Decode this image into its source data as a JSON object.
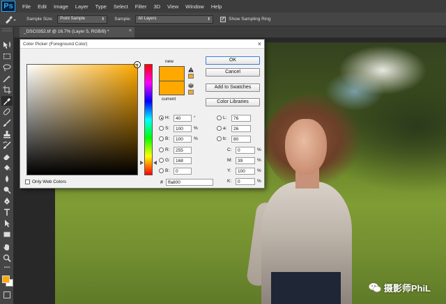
{
  "menubar": {
    "logo": "Ps",
    "items": [
      "File",
      "Edit",
      "Image",
      "Layer",
      "Type",
      "Select",
      "Filter",
      "3D",
      "View",
      "Window",
      "Help"
    ]
  },
  "options_bar": {
    "sample_size_label": "Sample Size:",
    "sample_size_value": "Point Sample",
    "sample_label": "Sample:",
    "sample_value": "All Layers",
    "show_ring_label": "Show Sampling Ring",
    "show_ring_checked": true
  },
  "document_tab": {
    "title": "_DSC0352.tif @ 16.7% (Layer 5, RGB/8) *",
    "close": "×"
  },
  "color_picker": {
    "title": "Color Picker (Foreground Color)",
    "close": "×",
    "new_label": "new",
    "current_label": "current",
    "new_color": "#ffa800",
    "current_color": "#ffa800",
    "buttons": {
      "ok": "OK",
      "cancel": "Cancel",
      "add_to_swatches": "Add to Swatches",
      "color_libraries": "Color Libraries"
    },
    "hsb": {
      "h_label": "H:",
      "h_value": "40",
      "h_unit": "°",
      "s_label": "S:",
      "s_value": "100",
      "s_unit": "%",
      "b_label": "B:",
      "b_value": "100",
      "b_unit": "%"
    },
    "rgb": {
      "r_label": "R:",
      "r_value": "255",
      "g_label": "G:",
      "g_value": "168",
      "b_label": "B:",
      "b_value": "0"
    },
    "lab": {
      "l_label": "L:",
      "l_value": "76",
      "a_label": "a:",
      "a_value": "26",
      "b_label": "b:",
      "b_value": "80"
    },
    "cmyk": {
      "c_label": "C:",
      "c_value": "0",
      "c_unit": "%",
      "m_label": "M:",
      "m_value": "39",
      "m_unit": "%",
      "y_label": "Y:",
      "y_value": "100",
      "y_unit": "%",
      "k_label": "K:",
      "k_value": "0",
      "k_unit": "%"
    },
    "only_web_colors": "Only Web Colors",
    "hex_symbol": "#",
    "hex_value": "ffa800"
  },
  "toolbox": {
    "foreground_color": "#ffa800",
    "background_color": "#ffffff",
    "tools": [
      "move-tool",
      "marquee-tool",
      "lasso-tool",
      "quick-selection-tool",
      "crop-tool",
      "eyedropper-tool",
      "healing-brush-tool",
      "brush-tool",
      "clone-stamp-tool",
      "history-brush-tool",
      "eraser-tool",
      "gradient-tool",
      "blur-tool",
      "dodge-tool",
      "pen-tool",
      "type-tool",
      "path-selection-tool",
      "rectangle-tool",
      "hand-tool",
      "zoom-tool"
    ]
  },
  "watermark": {
    "text": "摄影师PhiL"
  },
  "colors": {
    "ps_blue": "#31a8ff",
    "panel_dark": "#3c3c3c",
    "panel_mid": "#454545",
    "accent_orange": "#ffa800"
  }
}
